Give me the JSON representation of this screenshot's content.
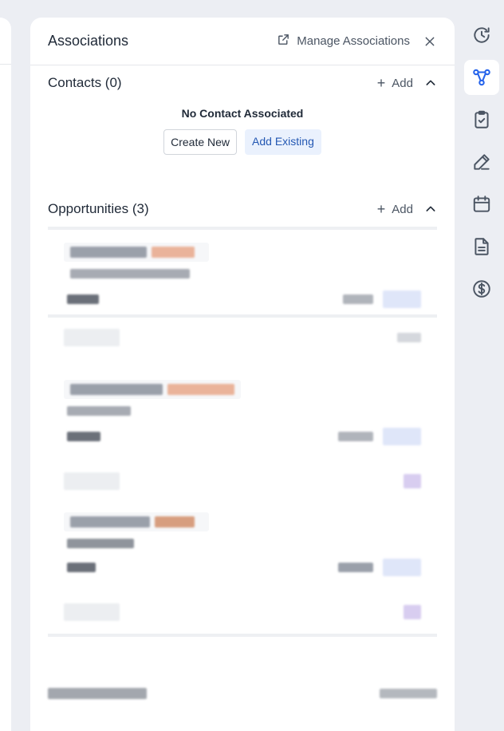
{
  "panel": {
    "title": "Associations",
    "manage_label": "Manage Associations"
  },
  "contacts": {
    "title": "Contacts (0)",
    "add_label": "Add",
    "empty_text": "No Contact Associated",
    "create_new_label": "Create New",
    "add_existing_label": "Add Existing"
  },
  "opportunities": {
    "title": "Opportunities (3)",
    "add_label": "Add"
  },
  "colors": {
    "accent": "#2458b3",
    "accent_soft": "#eaf1fd",
    "active_icon": "#2563eb"
  },
  "rail": {
    "icons": [
      "history-icon",
      "associations-icon",
      "tasks-icon",
      "notes-icon",
      "calendar-icon",
      "documents-icon",
      "payments-icon"
    ],
    "active": "associations-icon"
  }
}
